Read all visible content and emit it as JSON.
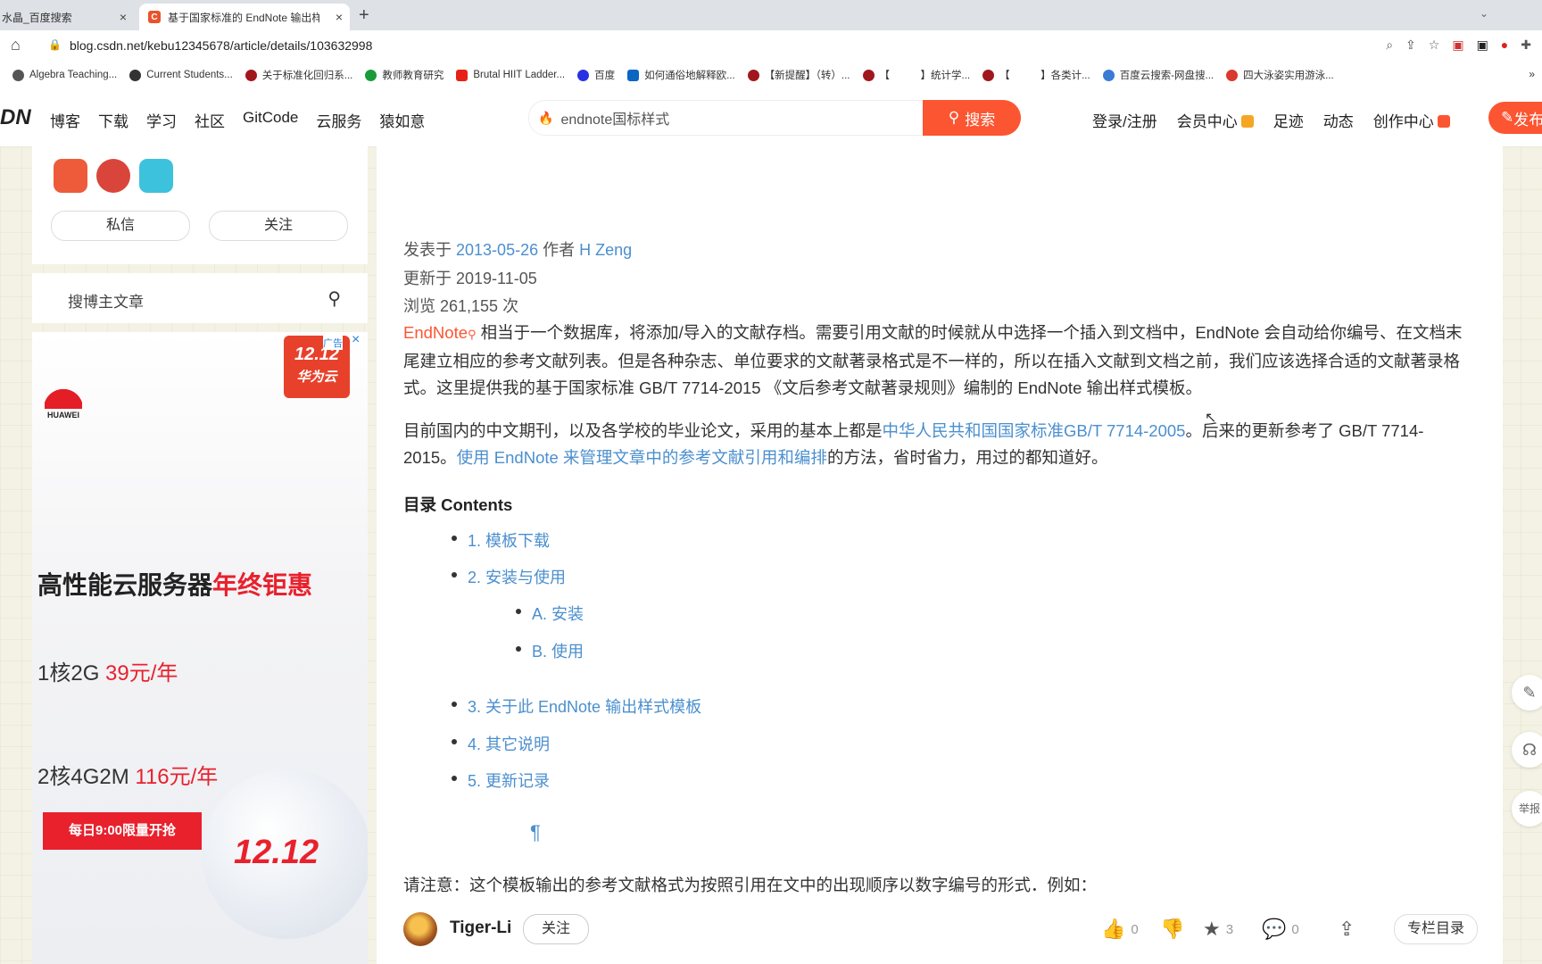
{
  "tabs": [
    {
      "title": "水晶_百度搜索",
      "close": "×"
    },
    {
      "title": "基于国家标准的 EndNote 输出样式",
      "close": "×",
      "favicon": "C"
    }
  ],
  "newtab": "+",
  "address": {
    "url": "blog.csdn.net/kebu12345678/article/details/103632998"
  },
  "bookmarks": [
    {
      "label": "Algebra Teaching...",
      "color": "#555555"
    },
    {
      "label": "Current Students...",
      "color": "#333333"
    },
    {
      "label": "关于标准化回归系...",
      "color": "#a0181e"
    },
    {
      "label": "教师教育研究",
      "color": "#1a9b3a"
    },
    {
      "label": "Brutal HIIT Ladder...",
      "color": "#e62117"
    },
    {
      "label": "百度",
      "color": "#2932e1"
    },
    {
      "label": "如何通俗地解释欧...",
      "color": "#0a66c2"
    },
    {
      "label": "【新提醒】（转）...",
      "color": "#a0181e"
    },
    {
      "label": "【　　　】统计学...",
      "color": "#a0181e"
    },
    {
      "label": "【　　　】各类计...",
      "color": "#a0181e"
    },
    {
      "label": "百度云搜索-网盘搜...",
      "color": "#3a7bd5"
    },
    {
      "label": "四大泳姿实用游泳...",
      "color": "#d83a2d"
    }
  ],
  "bookmarks_more": "»",
  "header": {
    "logo": "DN",
    "nav": [
      "博客",
      "下载",
      "学习",
      "社区",
      "GitCode",
      "云服务",
      "猿如意"
    ],
    "search_text": "endnote国标样式",
    "search_button": "搜索",
    "right_nav": [
      "登录/注册",
      "会员中心",
      "足迹",
      "动态",
      "创作中心"
    ],
    "publish": "发布"
  },
  "sidebar": {
    "message_button": "私信",
    "follow_button": "关注",
    "search_placeholder": "搜博主文章"
  },
  "ad": {
    "brand": "HUAWEI",
    "badge_top": "12.12",
    "badge_bottom": "华为云",
    "ad_label": "广告",
    "close": "×",
    "headline_a": "高性能云服务器",
    "headline_b": "年终钜惠",
    "offer1_a": "1核2G ",
    "offer1_b": "39元/年",
    "offer2_a": "2核4G2M ",
    "offer2_b": "116元/年",
    "limit": "每日9:00限量开抢",
    "ball_text": "12.12"
  },
  "article": {
    "published_prefix": "发表于 ",
    "published_date": "2013-05-26",
    "author_prefix": " 作者 ",
    "author": "H Zeng",
    "updated": "更新于 2019-11-05",
    "views": "浏览 261,155 次",
    "keyword": "EndNote",
    "para1": "相当于一个数据库，将添加/导入的文献存档。需要引用文献的时候就从中选择一个插入到文档中，EndNote 会自动给你编号、在文档末尾建立相应的参考文献列表。但是各种杂志、单位要求的文献著录格式是不一样的，所以在插入文献到文档之前，我们应该选择合适的文献著录格式。这里提供我的基于国家标准 GB/T 7714-2015 《文后参考文献著录规则》编制的 EndNote 输出样式模板。",
    "para2_a": "目前国内的中文期刊，以及各学校的毕业论文，采用的基本上都是",
    "para2_link1": "中华人民共和国国家标准GB/T 7714-2005",
    "para2_b": "。后来的更新参考了 GB/T 7714-2015。",
    "para2_link2": "使用 EndNote 来管理文章中的参考文献引用和编排",
    "para2_c": "的方法，省时省力，用过的都知道好。",
    "toc_heading": "目录 Contents",
    "toc": [
      "1. 模板下载",
      "2. 安装与使用",
      "A. 安装",
      "B. 使用",
      "3. 关于此 EndNote 输出样式模板",
      "4. 其它说明",
      "5. 更新记录"
    ],
    "pilcrow": "¶",
    "note": "请注意：这个模板输出的参考文献格式为按照引用在文中的出现顺序以数字编号的形式．例如："
  },
  "authorbar": {
    "name": "Tiger-Li",
    "follow": "关注",
    "likes": "0",
    "stars": "3",
    "comments": "0",
    "column": "专栏目录"
  },
  "floating": [
    "✎",
    "☊",
    "举报"
  ]
}
